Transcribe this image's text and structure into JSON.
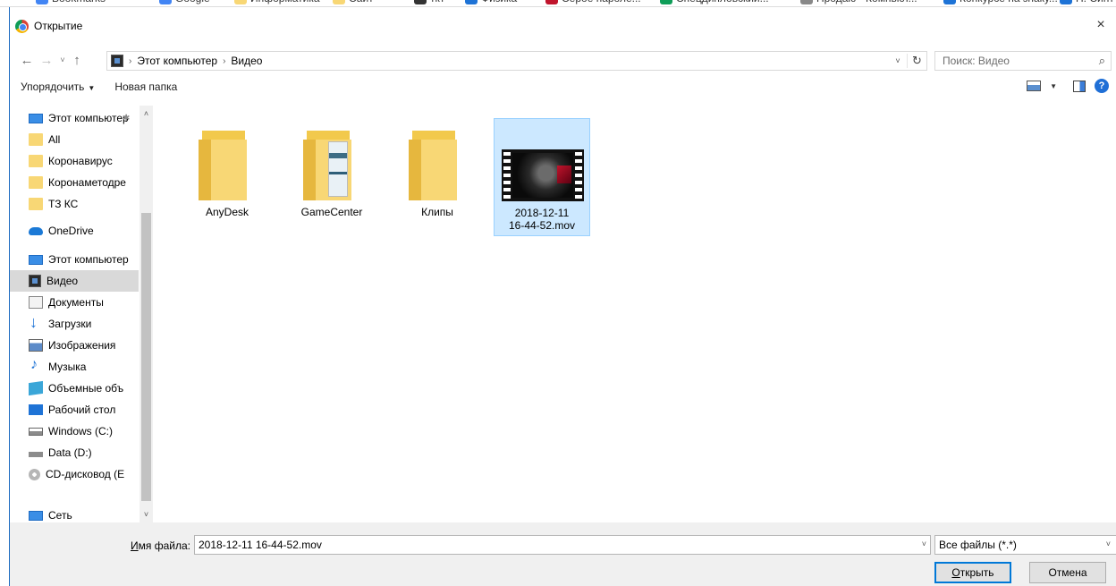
{
  "bookmarks": [
    {
      "label": "Bookmarks",
      "color": "#4285f4"
    },
    {
      "label": "Google",
      "color": "#4285f4"
    },
    {
      "label": "Информатика",
      "color": "#f8d775"
    },
    {
      "label": "Сайт",
      "color": "#f8d775"
    },
    {
      "label": "ткт",
      "color": "#333333"
    },
    {
      "label": "Физика",
      "color": "#1e73d6"
    },
    {
      "label": "Серое пароле...",
      "color": "#c0142c"
    },
    {
      "label": "Спецдипловский...",
      "color": "#0f9d58"
    },
    {
      "label": "Продаю · Компьют...",
      "color": "#888888"
    },
    {
      "label": "Конкурсе на знаку...",
      "color": "#1e73d6"
    },
    {
      "label": "Н. Синт",
      "color": "#1e73d6"
    }
  ],
  "dialog": {
    "title": "Открытие",
    "close_glyph": "×"
  },
  "address": {
    "back_glyph": "←",
    "forward_glyph": "→",
    "recent_glyph": "˅",
    "up_glyph": "↑",
    "crumbs": [
      "Этот компьютер",
      "Видео"
    ],
    "separator": "›",
    "dropdown_glyph": "˅",
    "refresh_glyph": "↻"
  },
  "search": {
    "placeholder": "Поиск: Видео",
    "icon_glyph": "⌕"
  },
  "toolbar": {
    "organize_label": "Упорядочить",
    "new_folder_label": "Новая папка",
    "caret": "▼",
    "help_glyph": "?"
  },
  "nav": {
    "items": [
      {
        "label": "Этот компьютер",
        "icon": "pc"
      },
      {
        "label": "All",
        "icon": "folder"
      },
      {
        "label": "Коронавирус",
        "icon": "folder"
      },
      {
        "label": "Коронаметодре",
        "icon": "folder"
      },
      {
        "label": "ТЗ КС",
        "icon": "folder"
      },
      {
        "label": "OneDrive",
        "icon": "cloud"
      },
      {
        "label": "Этот компьютер",
        "icon": "pc"
      },
      {
        "label": "Видео",
        "icon": "video",
        "selected": true
      },
      {
        "label": "Документы",
        "icon": "docs"
      },
      {
        "label": "Загрузки",
        "icon": "down"
      },
      {
        "label": "Изображения",
        "icon": "pics"
      },
      {
        "label": "Музыка",
        "icon": "music"
      },
      {
        "label": "Объемные объ",
        "icon": "cube"
      },
      {
        "label": "Рабочий стол",
        "icon": "desk"
      },
      {
        "label": "Windows (C:)",
        "icon": "drivec"
      },
      {
        "label": "Data (D:)",
        "icon": "drived"
      },
      {
        "label": "CD-дисковод (E",
        "icon": "cd"
      },
      {
        "label": "Сеть",
        "icon": "net"
      }
    ],
    "pin_glyph": "✱",
    "scroll_up": "˄",
    "scroll_down": "˅"
  },
  "files": [
    {
      "name": "AnyDesk",
      "type": "folder"
    },
    {
      "name": "GameCenter",
      "type": "folder-doc"
    },
    {
      "name": "Клипы",
      "type": "folder"
    },
    {
      "name_line1": "2018-12-11",
      "name_line2": "16-44-52.mov",
      "type": "video",
      "selected": true
    }
  ],
  "bottom": {
    "filename_label_underlined": "И",
    "filename_label_rest": "мя файла:",
    "filename_value": "2018-12-11 16-44-52.mov",
    "filetype_value": "Все файлы (*.*)",
    "dropdown_glyph": "˅",
    "open_underlined": "О",
    "open_rest": "ткрыть",
    "cancel_label": "Отмена"
  }
}
